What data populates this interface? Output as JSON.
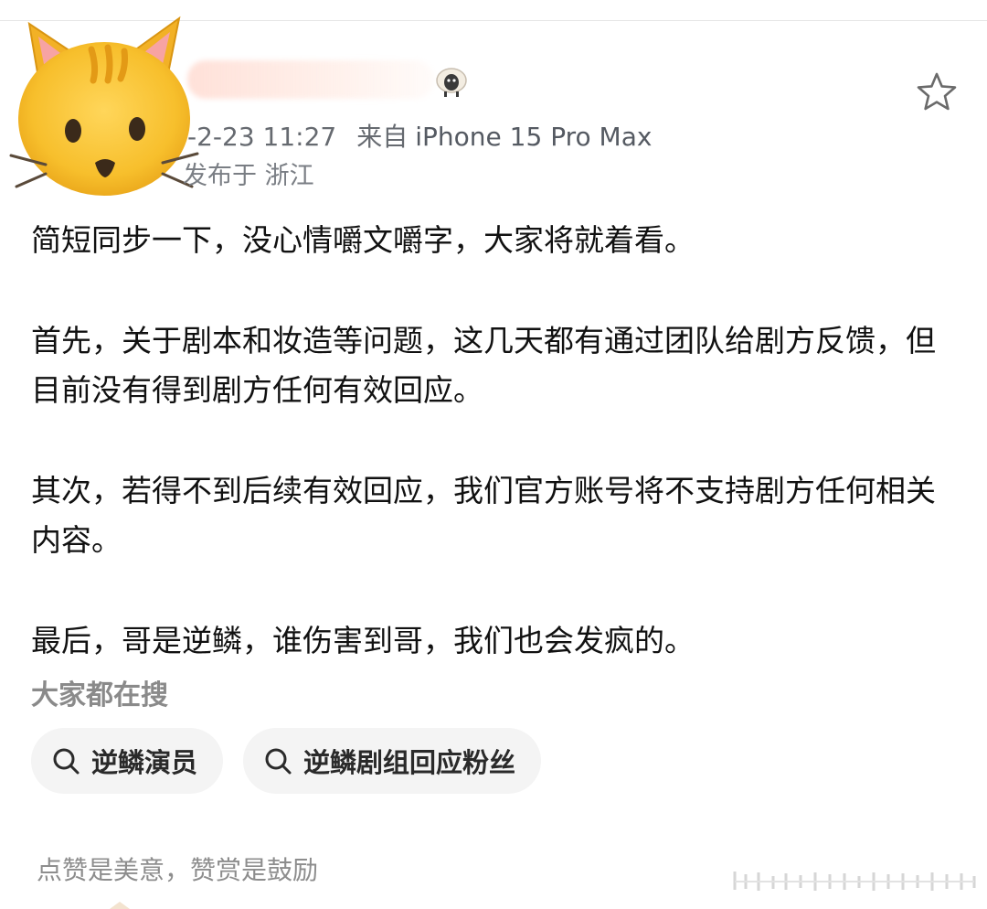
{
  "post": {
    "timestamp": "-2-23 11:27",
    "source_label": "来自",
    "device": "iPhone 15 Pro Max",
    "location": "发布于 浙江",
    "paragraphs": [
      "简短同步一下，没心情嚼文嚼字，大家将就着看。",
      "首先，关于剧本和妆造等问题，这几天都有通过团队给剧方反馈，但目前没有得到剧方任何有效回应。",
      "其次，若得不到后续有效回应，我们官方账号将不支持剧方任何相关内容。",
      "最后，哥是逆鳞，谁伤害到哥，我们也会发疯的。"
    ]
  },
  "search": {
    "title": "大家都在搜",
    "chips": [
      {
        "label": "逆鳞演员",
        "icon": "search-icon"
      },
      {
        "label": "逆鳞剧组回应粉丝",
        "icon": "search-icon"
      }
    ]
  },
  "reward": {
    "text": "点赞是美意，赞赏是鼓励"
  },
  "icons": {
    "avatar": "cat-emoji-avatar",
    "badge": "sheep-icon",
    "favorite": "star-icon"
  },
  "colors": {
    "meta_text": "#666a70",
    "chip_bg": "#f4f4f4",
    "section_title": "#8a8a8a",
    "cat_yellow": "#f5b92a"
  }
}
